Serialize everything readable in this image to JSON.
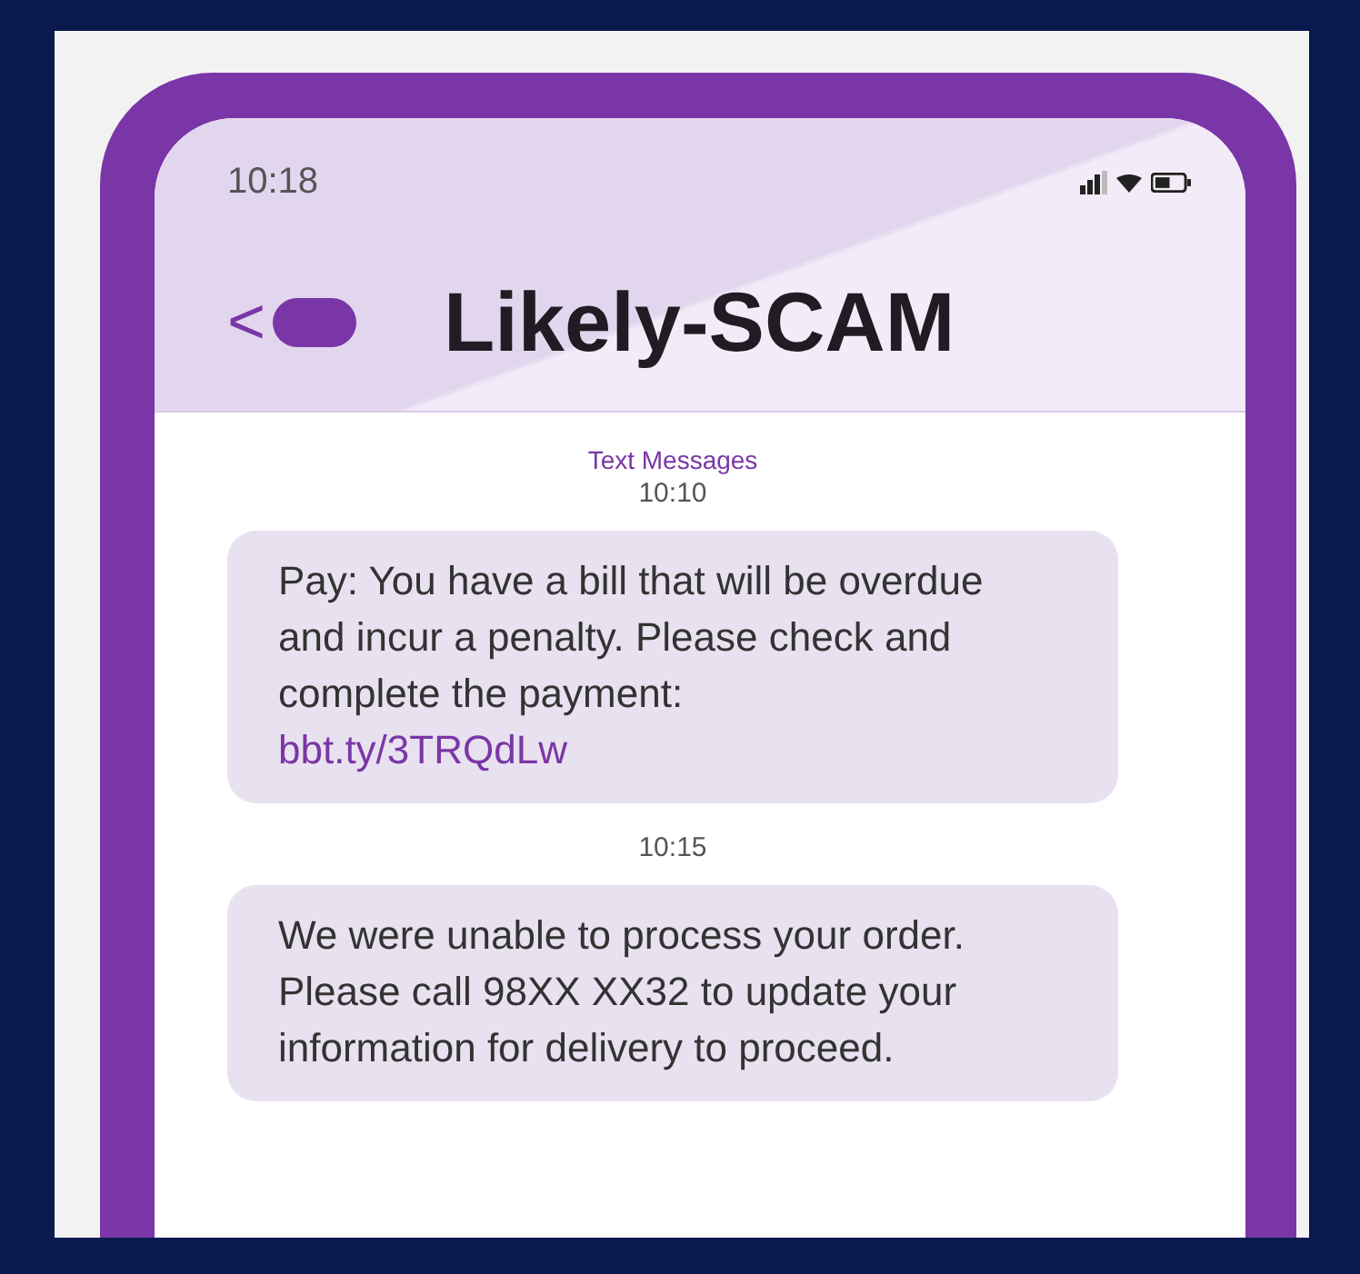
{
  "status_bar": {
    "time": "10:18"
  },
  "header": {
    "back_icon": "<",
    "title": "Likely-SCAM"
  },
  "thread": {
    "label": "Text Messages",
    "messages": [
      {
        "kind": "incoming",
        "time": "10:10",
        "text": "Pay: You have a bill that will be overdue and incur a penalty. Please check and complete the payment:",
        "link": "bbt.ty/3TRQdLw"
      },
      {
        "kind": "incoming",
        "time": "10:15",
        "text": "We were unable to process your order. Please call 98XX XX32 to update your information for delivery to proceed."
      }
    ]
  }
}
